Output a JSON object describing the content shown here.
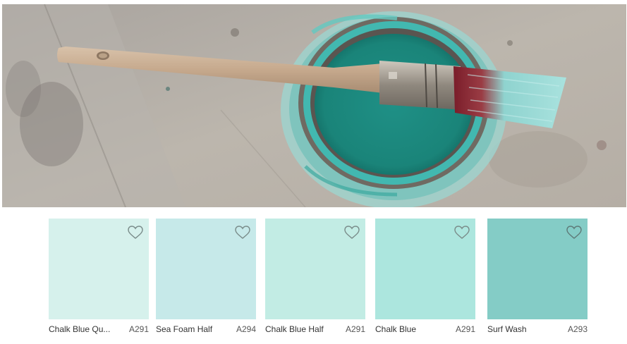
{
  "hero": {
    "image_icon": "paint-can-with-brush-photo",
    "colors": {
      "floor": "#b3aca4",
      "paint": "#1f8e84",
      "paint_rim": "#42b8b0",
      "handle": "#c9ad92",
      "ferrule": "#9c958a",
      "bristles": "#8fd3cf",
      "bristle_tip": "#8a2a33"
    }
  },
  "swatches": [
    {
      "name": "Chalk Blue Qu...",
      "code": "A291",
      "color": "#d6f1ec",
      "favorite_icon": "heart-outline-icon"
    },
    {
      "name": "Sea Foam Half",
      "code": "A294",
      "color": "#c6e9e9",
      "favorite_icon": "heart-outline-icon"
    },
    {
      "name": "Chalk Blue Half",
      "code": "A291",
      "color": "#c2ece4",
      "favorite_icon": "heart-outline-icon"
    },
    {
      "name": "Chalk Blue",
      "code": "A291",
      "color": "#ace6de",
      "favorite_icon": "heart-outline-icon"
    },
    {
      "name": "Surf Wash",
      "code": "A293",
      "color": "#84ccc6",
      "favorite_icon": "heart-outline-icon"
    }
  ]
}
